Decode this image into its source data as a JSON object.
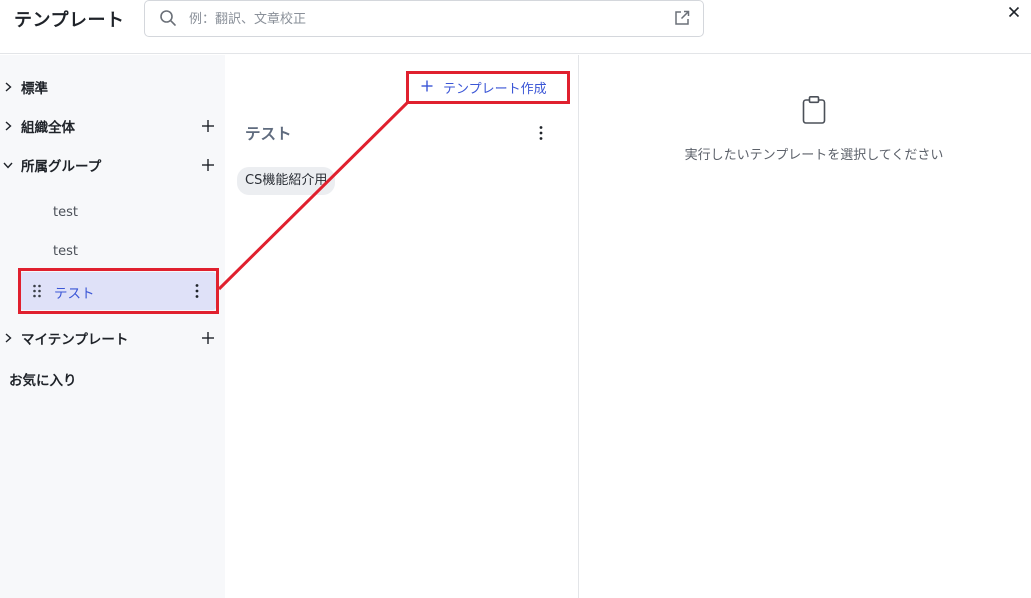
{
  "header": {
    "title": "テンプレート",
    "search_placeholder": "例：翻訳、文章校正"
  },
  "sidebar": {
    "categories": [
      {
        "label": "標準",
        "expanded": false,
        "has_add": false
      },
      {
        "label": "組織全体",
        "expanded": false,
        "has_add": true
      },
      {
        "label": "所属グループ",
        "expanded": true,
        "has_add": true
      },
      {
        "label": "マイテンプレート",
        "expanded": false,
        "has_add": true
      }
    ],
    "group_items": [
      "test",
      "test",
      "テスト"
    ],
    "selected_item": "テスト",
    "favorites_label": "お気に入り"
  },
  "middle": {
    "create_label": "テンプレート作成",
    "group_title": "テスト",
    "templates": [
      "CS機能紹介用"
    ]
  },
  "right": {
    "empty_message": "実行したいテンプレートを選択してください"
  },
  "colors": {
    "accent": "#3b56d6",
    "selected_bg": "#dfe1f8",
    "sidebar_bg": "#f7f8fa",
    "annotation": "#e0202e"
  },
  "icons": [
    "search-icon",
    "external-link-icon",
    "close-icon",
    "chevron-right-icon",
    "chevron-down-icon",
    "plus-icon",
    "drag-handle-icon",
    "more-vertical-icon",
    "clipboard-icon"
  ]
}
